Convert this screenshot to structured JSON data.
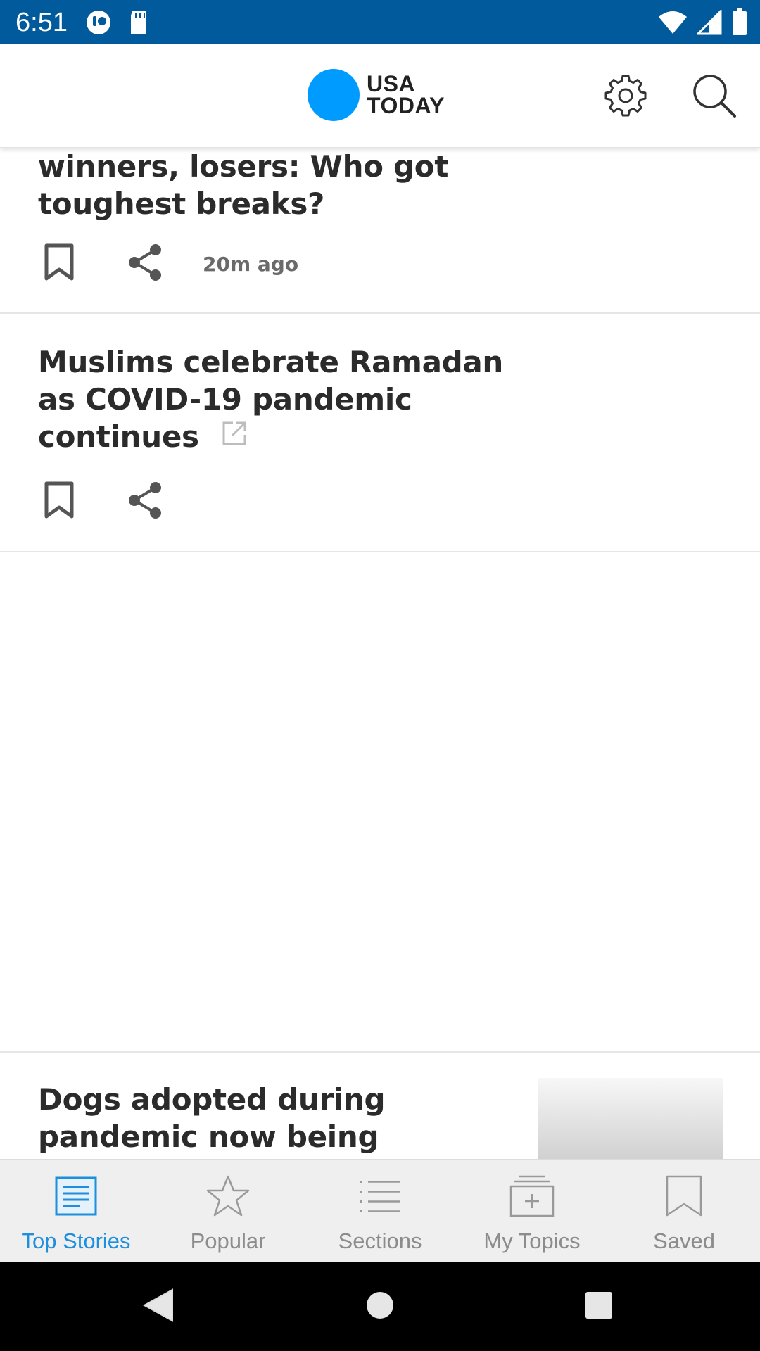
{
  "status_bar": {
    "time": "6:51",
    "left_icons": [
      "notification-icon",
      "sd-card-icon"
    ],
    "right_icons": [
      "wifi-icon",
      "cell-signal-icon",
      "battery-icon"
    ],
    "background": "#005a9c"
  },
  "header": {
    "logo_line1": "USA",
    "logo_line2": "TODAY",
    "logo_color": "#009bff",
    "settings_icon": "gear-icon",
    "search_icon": "search-icon"
  },
  "stories": [
    {
      "headline_line1": "winners, losers: Who got",
      "headline_line2": "toughest breaks?",
      "timestamp": "20m ago"
    },
    {
      "headline_line1": "Muslims celebrate Ramadan",
      "headline_line2": "as COVID-19 pandemic",
      "headline_line3": "continues",
      "external_link": true
    },
    {
      "headline_line1": "Dogs adopted during",
      "headline_line2": "pandemic now being"
    }
  ],
  "tabs": [
    {
      "label": "Top Stories",
      "icon": "newspaper-icon",
      "active": true
    },
    {
      "label": "Popular",
      "icon": "star-icon",
      "active": false
    },
    {
      "label": "Sections",
      "icon": "list-icon",
      "active": false
    },
    {
      "label": "My Topics",
      "icon": "add-topic-icon",
      "active": false
    },
    {
      "label": "Saved",
      "icon": "bookmark-icon",
      "active": false
    }
  ],
  "colors": {
    "accent": "#1e8fdc",
    "inactive": "#8c8c8c",
    "headline": "#2b2b2b"
  }
}
